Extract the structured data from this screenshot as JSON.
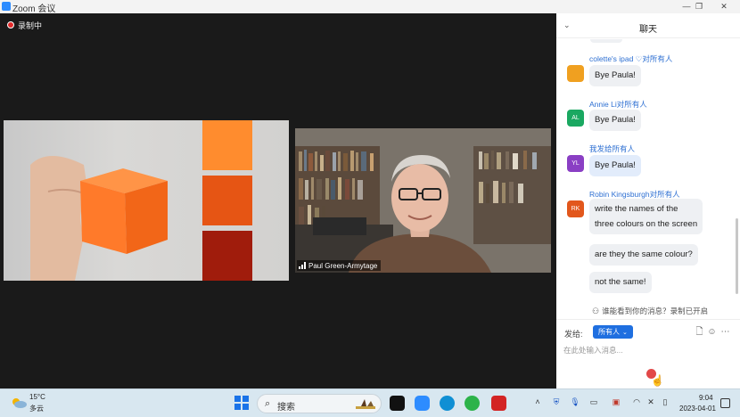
{
  "window": {
    "title": "Zoom 会议",
    "controls": {
      "minimize": "—",
      "restore": "❐",
      "close": "✕"
    }
  },
  "stage": {
    "recording_label": "录制中",
    "shared_tile": {
      "cube_color": "#ff7a2a",
      "swatches": [
        "#ff8c2e",
        "#e65514",
        "#a01c0c"
      ]
    },
    "video_tile": {
      "participant_name": "Paul Green-Armytage"
    }
  },
  "chat": {
    "title": "聊天",
    "messages": [
      {
        "sender": "colette's ipad ♡对所有人",
        "avatar": "",
        "avatar_color": "#f0a020",
        "lines": [
          "Bye Paula!"
        ]
      },
      {
        "sender": "Annie Li对所有人",
        "avatar": "AL",
        "avatar_color": "#1aa861",
        "lines": [
          "Bye Paula!"
        ]
      },
      {
        "sender": "我发给所有人",
        "avatar": "YL",
        "avatar_color": "#8a3fc4",
        "lines": [
          "Bye Paula!"
        ]
      },
      {
        "sender": "Robin Kingsburgh对所有人",
        "avatar": "RK",
        "avatar_color": "#e2571c",
        "lines": [
          "write the names of the",
          "three colours on the screen",
          "are they the same colour?",
          "not the same!"
        ]
      }
    ],
    "privacy_note": "谁能看到你的消息？录制已开启",
    "composer": {
      "to_label": "发给:",
      "recipient": "所有人",
      "placeholder": "在此处输入消息..."
    }
  },
  "taskbar": {
    "weather": {
      "temp": "15°C",
      "desc": "多云"
    },
    "search_label": "搜索",
    "clock": {
      "time": "9:04",
      "date": "2023-04-01"
    },
    "colors": {
      "windows": "#1a73e8",
      "capcut": "#111111",
      "zoom": "#2d8cff",
      "edge": "#0f8fd4",
      "wechat": "#2cb34a",
      "recorder": "#d32424"
    }
  }
}
